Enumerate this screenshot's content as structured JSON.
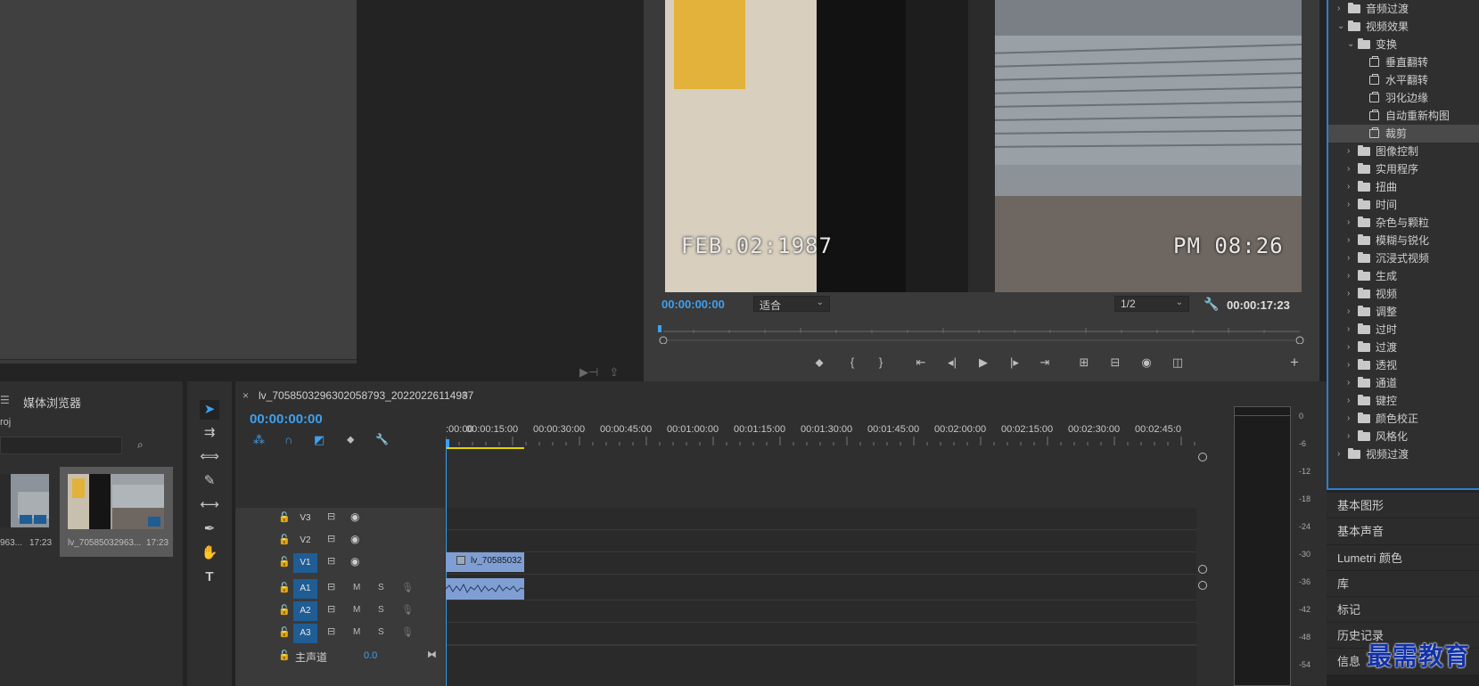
{
  "program_monitor": {
    "timecode_current": "00:00:00:00",
    "fit_dropdown": "适合",
    "resolution_dropdown": "1/2",
    "timecode_duration": "00:00:17:23",
    "video_overlay_date": "FEB.02:1987",
    "video_overlay_time": "PM 08:26"
  },
  "effects_panel": {
    "items": [
      {
        "label": "音频过渡",
        "level": 0,
        "type": "folder",
        "expanded": false
      },
      {
        "label": "视频效果",
        "level": 0,
        "type": "folder",
        "expanded": true
      },
      {
        "label": "变换",
        "level": 1,
        "type": "folder",
        "expanded": true
      },
      {
        "label": "垂直翻转",
        "level": 2,
        "type": "effect"
      },
      {
        "label": "水平翻转",
        "level": 2,
        "type": "effect"
      },
      {
        "label": "羽化边缘",
        "level": 2,
        "type": "effect"
      },
      {
        "label": "自动重新构图",
        "level": 2,
        "type": "effect"
      },
      {
        "label": "裁剪",
        "level": 2,
        "type": "effect",
        "selected": true
      },
      {
        "label": "图像控制",
        "level": 1,
        "type": "folder",
        "expanded": false
      },
      {
        "label": "实用程序",
        "level": 1,
        "type": "folder",
        "expanded": false
      },
      {
        "label": "扭曲",
        "level": 1,
        "type": "folder",
        "expanded": false
      },
      {
        "label": "时间",
        "level": 1,
        "type": "folder",
        "expanded": false
      },
      {
        "label": "杂色与颗粒",
        "level": 1,
        "type": "folder",
        "expanded": false
      },
      {
        "label": "模糊与锐化",
        "level": 1,
        "type": "folder",
        "expanded": false
      },
      {
        "label": "沉浸式视频",
        "level": 1,
        "type": "folder",
        "expanded": false
      },
      {
        "label": "生成",
        "level": 1,
        "type": "folder",
        "expanded": false
      },
      {
        "label": "视频",
        "level": 1,
        "type": "folder",
        "expanded": false
      },
      {
        "label": "调整",
        "level": 1,
        "type": "folder",
        "expanded": false
      },
      {
        "label": "过时",
        "level": 1,
        "type": "folder",
        "expanded": false
      },
      {
        "label": "过渡",
        "level": 1,
        "type": "folder",
        "expanded": false
      },
      {
        "label": "透视",
        "level": 1,
        "type": "folder",
        "expanded": false
      },
      {
        "label": "通道",
        "level": 1,
        "type": "folder",
        "expanded": false
      },
      {
        "label": "键控",
        "level": 1,
        "type": "folder",
        "expanded": false
      },
      {
        "label": "颜色校正",
        "level": 1,
        "type": "folder",
        "expanded": false
      },
      {
        "label": "风格化",
        "level": 1,
        "type": "folder",
        "expanded": false
      },
      {
        "label": "视频过渡",
        "level": 0,
        "type": "folder",
        "expanded": false
      }
    ]
  },
  "side_panels": [
    "基本图形",
    "基本声音",
    "Lumetri 颜色",
    "库",
    "标记",
    "历史记录",
    "信息"
  ],
  "project_panel": {
    "tab_label": "媒体浏览器",
    "path_text": "roj",
    "clips": [
      {
        "name": "963...",
        "duration": "17:23"
      },
      {
        "name": "lv_70585032963...",
        "duration": "17:23"
      }
    ]
  },
  "timeline": {
    "sequence_name": "lv_705850329630205879 3_20220226114937",
    "sequence_title": "lv_7058503296302058793_20220226114937",
    "menu_icon": "≡",
    "timecode": "00:00:00:00",
    "ruler_labels": [
      ":00:00",
      "00:00:15:00",
      "00:00:30:00",
      "00:00:45:00",
      "00:01:00:00",
      "00:01:15:00",
      "00:01:30:00",
      "00:01:45:00",
      "00:02:00:00",
      "00:02:15:00",
      "00:02:30:00",
      "00:02:45:0"
    ],
    "video_tracks": [
      "V3",
      "V2",
      "V1"
    ],
    "audio_tracks": [
      "A1",
      "A2",
      "A3"
    ],
    "mix_label": "主声道",
    "mix_value": "0.0",
    "clip_label": "lv_70585032",
    "m_label": "M",
    "s_label": "S"
  },
  "meter": {
    "db_labels": [
      "0",
      "-6",
      "-12",
      "-18",
      "-24",
      "-30",
      "-36",
      "-42",
      "-48",
      "-54"
    ]
  },
  "watermark": "最需教育",
  "colors": {
    "accent_blue": "#3fa0ee",
    "track_on": "#1f5d94",
    "clip": "#7f9fd4",
    "selection_border": "#2d7fcf"
  }
}
